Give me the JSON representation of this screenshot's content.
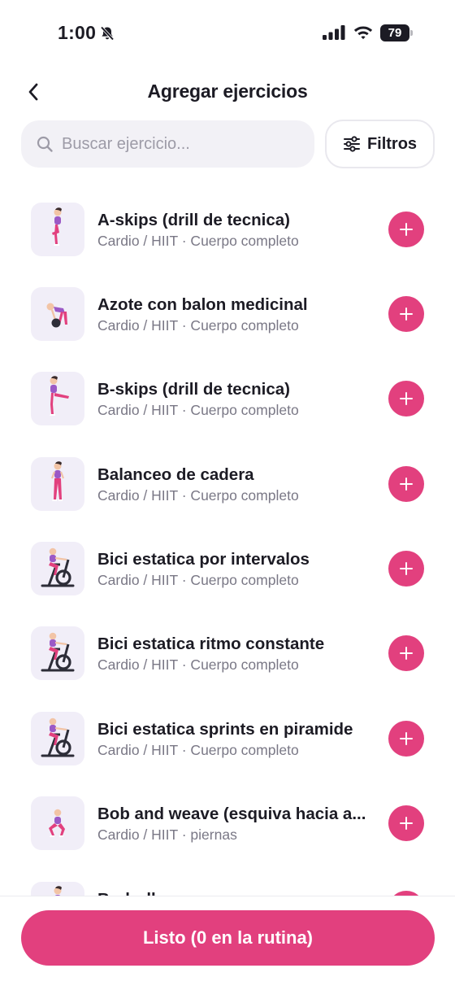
{
  "status_bar": {
    "time": "1:00",
    "battery": "79"
  },
  "header": {
    "title": "Agregar ejercicios"
  },
  "search": {
    "placeholder": "Buscar ejercicio..."
  },
  "filters": {
    "label": "Filtros"
  },
  "exercises": [
    {
      "name": "A-skips (drill de tecnica)",
      "meta": "Cardio / HIIT · Cuerpo completo",
      "icon": "high-knee-figure-icon"
    },
    {
      "name": "Azote con balon medicinal",
      "meta": "Cardio / HIIT · Cuerpo completo",
      "icon": "medicine-ball-slam-figure-icon"
    },
    {
      "name": "B-skips (drill de tecnica)",
      "meta": "Cardio / HIIT · Cuerpo completo",
      "icon": "leg-extension-figure-icon"
    },
    {
      "name": "Balanceo de cadera",
      "meta": "Cardio / HIIT · Cuerpo completo",
      "icon": "standing-figure-icon"
    },
    {
      "name": "Bici estatica por intervalos",
      "meta": "Cardio / HIIT · Cuerpo completo",
      "icon": "stationary-bike-figure-icon"
    },
    {
      "name": "Bici estatica ritmo constante",
      "meta": "Cardio / HIIT · Cuerpo completo",
      "icon": "stationary-bike-figure-icon"
    },
    {
      "name": "Bici estatica sprints en piramide",
      "meta": "Cardio / HIIT · Cuerpo completo",
      "icon": "stationary-bike-figure-icon"
    },
    {
      "name": "Bob and weave (esquiva hacia a...",
      "meta": "Cardio / HIIT · piernas",
      "icon": "squat-figure-icon"
    },
    {
      "name": "Bod…ll…",
      "meta": "",
      "icon": "standing-figure-icon"
    }
  ],
  "footer": {
    "done_label": "Listo (0 en la rutina)"
  },
  "colors": {
    "accent": "#e2407e",
    "thumb_bg": "#f1eef8",
    "text": "#1c1b24",
    "muted": "#7a7886"
  }
}
